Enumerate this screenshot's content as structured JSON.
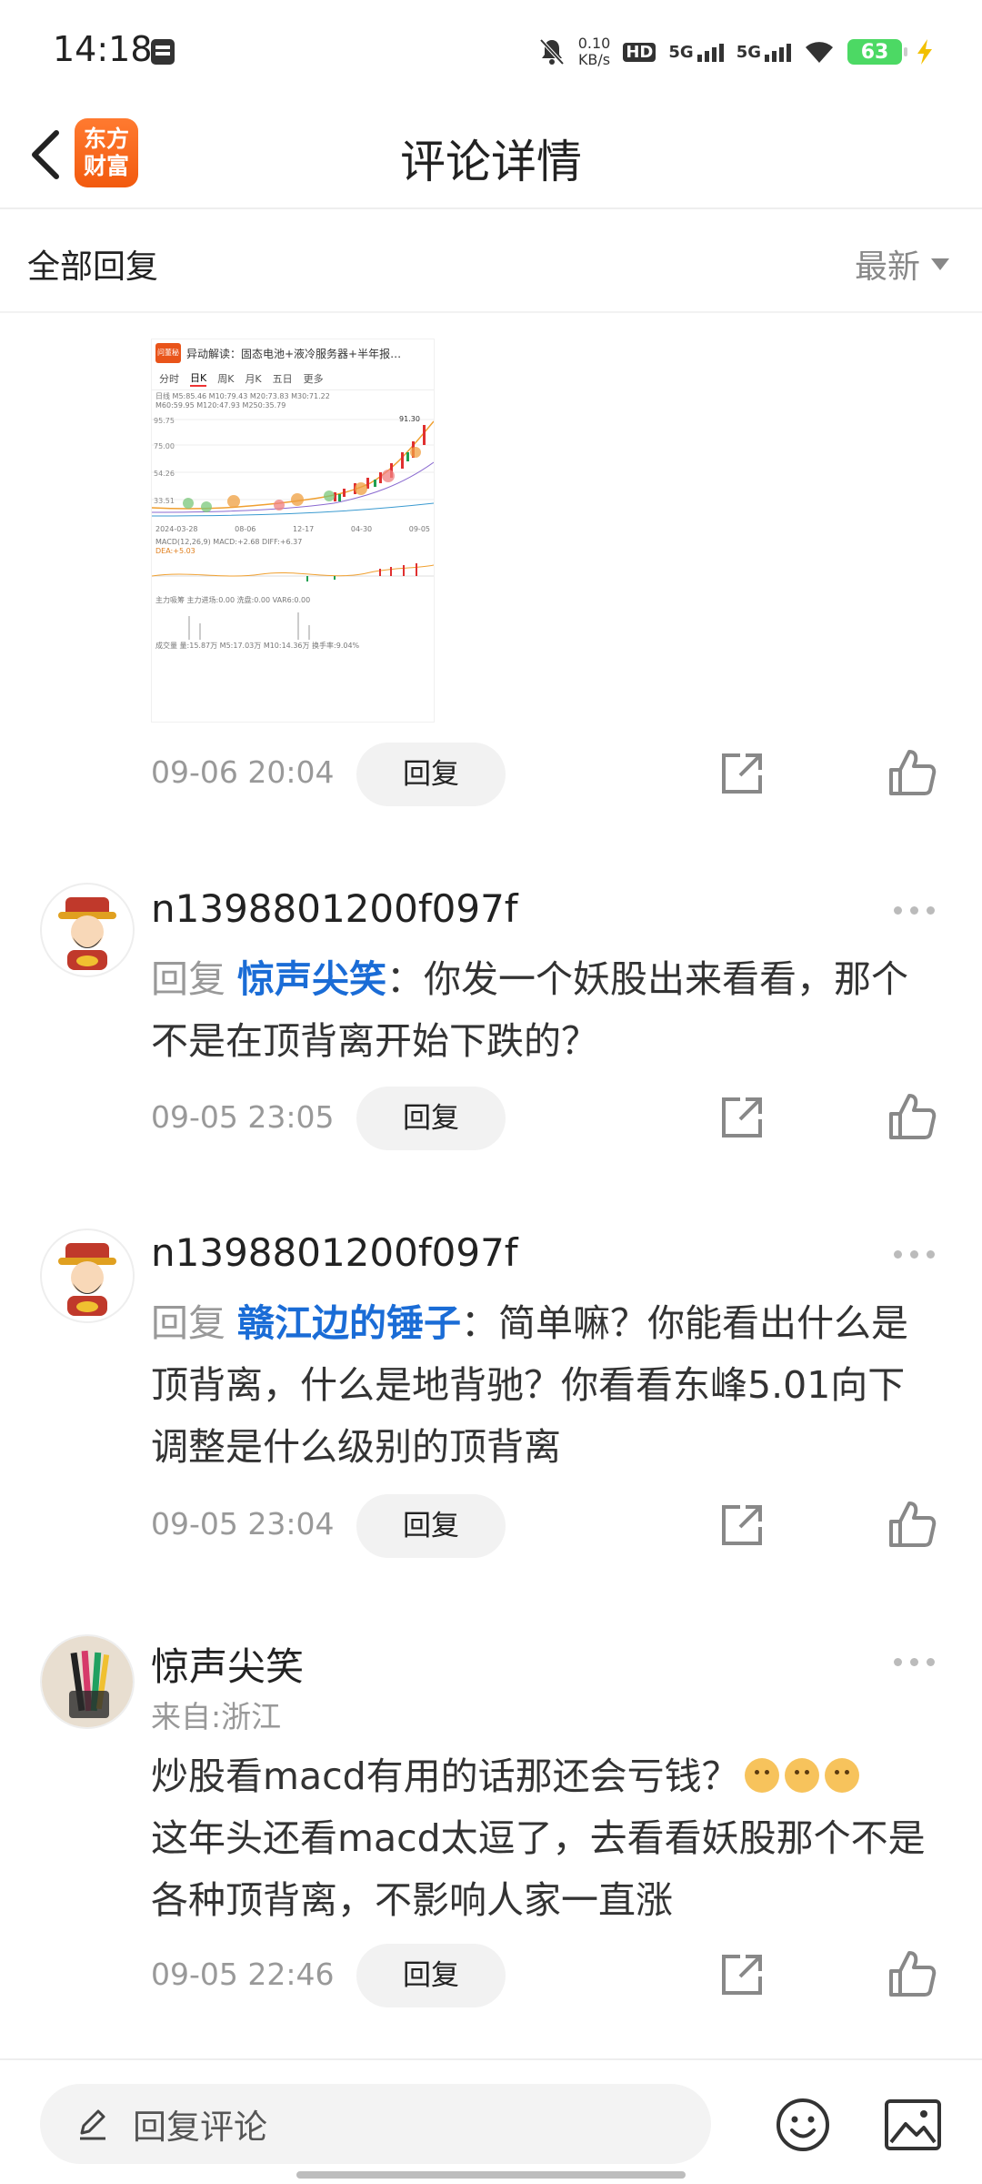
{
  "status_bar": {
    "time": "14:18",
    "net_speed_value": "0.10",
    "net_speed_unit": "KB/s",
    "hd_label": "HD",
    "sim1_label": "5G",
    "sim2_label": "5G",
    "battery": "63"
  },
  "header": {
    "logo_line1": "东方",
    "logo_line2": "财富",
    "title": "评论详情"
  },
  "section": {
    "title": "全部回复",
    "sort_label": "最新"
  },
  "thumbnail": {
    "headline": "异动解读：固态电池+液冷服务器+半年报…",
    "badge": "问董秘",
    "tabs": [
      "分时",
      "日K",
      "周K",
      "月K",
      "五日",
      "更多"
    ],
    "active_tab": "日K",
    "info_line1": "日线 M5:85.46 M10:79.43 M20:73.83 M30:71.22",
    "info_line2": "M60:59.95 M120:47.93 M250:35.79",
    "price_labels": [
      "95.75",
      "75.00",
      "54.26",
      "33.51"
    ],
    "peak_label": "91.30",
    "dates": [
      "2024-03-28",
      "08-06",
      "12-17",
      "04-30",
      "09-05"
    ],
    "macd_line": "MACD(12,26,9) MACD:+2.68 DIFF:+6.37",
    "dea_line": "DEA:+5.03",
    "flow_line": "主力吸筹 主力进场:0.00 洗盘:0.00 VAR6:0.00",
    "volume_line": "成交量 量:15.87万 M5:17.03万 M10:14.36万 换手率:9.04%",
    "time": "09-06 20:04"
  },
  "comments": [
    {
      "username": "n1398801200f097f",
      "reply_prefix": "回复",
      "reply_to": "惊声尖笑",
      "text": "：你发一个妖股出来看看，那个不是在顶背离开始下跌的？",
      "time": "09-05 23:05"
    },
    {
      "username": "n1398801200f097f",
      "reply_prefix": "回复",
      "reply_to": "赣江边的锤子",
      "text": "：简单嘛？你能看出什么是顶背离，什么是地背驰？你看看东峰5.01向下调整是什么级别的顶背离",
      "time": "09-05 23:04"
    },
    {
      "username": "惊声尖笑",
      "location": "来自:浙江",
      "text_line1": "炒股看macd有用的话那还会亏钱？",
      "text_line2": "这年头还看macd太逗了，去看看妖股那个不是各种顶背离，不影响人家一直涨",
      "time": "09-05 22:46"
    }
  ],
  "reply_label": "回复",
  "bottom_bar": {
    "placeholder": "回复评论"
  },
  "colors": {
    "accent_blue": "#1a6cd6",
    "brand_orange": "#f25a0e",
    "battery_green": "#4cd964"
  }
}
